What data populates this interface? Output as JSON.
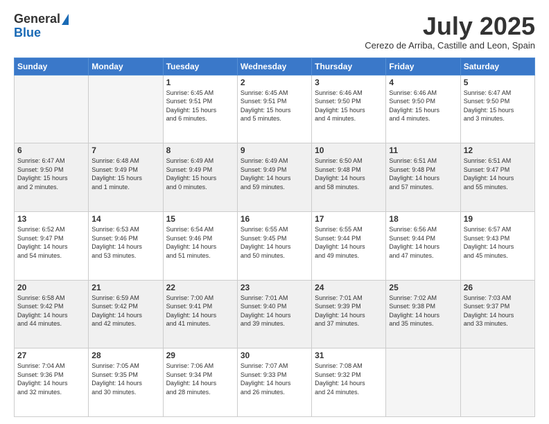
{
  "header": {
    "logo_general": "General",
    "logo_blue": "Blue",
    "month_title": "July 2025",
    "location": "Cerezo de Arriba, Castille and Leon, Spain"
  },
  "weekdays": [
    "Sunday",
    "Monday",
    "Tuesday",
    "Wednesday",
    "Thursday",
    "Friday",
    "Saturday"
  ],
  "weeks": [
    [
      {
        "day": "",
        "info": ""
      },
      {
        "day": "",
        "info": ""
      },
      {
        "day": "1",
        "info": "Sunrise: 6:45 AM\nSunset: 9:51 PM\nDaylight: 15 hours\nand 6 minutes."
      },
      {
        "day": "2",
        "info": "Sunrise: 6:45 AM\nSunset: 9:51 PM\nDaylight: 15 hours\nand 5 minutes."
      },
      {
        "day": "3",
        "info": "Sunrise: 6:46 AM\nSunset: 9:50 PM\nDaylight: 15 hours\nand 4 minutes."
      },
      {
        "day": "4",
        "info": "Sunrise: 6:46 AM\nSunset: 9:50 PM\nDaylight: 15 hours\nand 4 minutes."
      },
      {
        "day": "5",
        "info": "Sunrise: 6:47 AM\nSunset: 9:50 PM\nDaylight: 15 hours\nand 3 minutes."
      }
    ],
    [
      {
        "day": "6",
        "info": "Sunrise: 6:47 AM\nSunset: 9:50 PM\nDaylight: 15 hours\nand 2 minutes."
      },
      {
        "day": "7",
        "info": "Sunrise: 6:48 AM\nSunset: 9:49 PM\nDaylight: 15 hours\nand 1 minute."
      },
      {
        "day": "8",
        "info": "Sunrise: 6:49 AM\nSunset: 9:49 PM\nDaylight: 15 hours\nand 0 minutes."
      },
      {
        "day": "9",
        "info": "Sunrise: 6:49 AM\nSunset: 9:49 PM\nDaylight: 14 hours\nand 59 minutes."
      },
      {
        "day": "10",
        "info": "Sunrise: 6:50 AM\nSunset: 9:48 PM\nDaylight: 14 hours\nand 58 minutes."
      },
      {
        "day": "11",
        "info": "Sunrise: 6:51 AM\nSunset: 9:48 PM\nDaylight: 14 hours\nand 57 minutes."
      },
      {
        "day": "12",
        "info": "Sunrise: 6:51 AM\nSunset: 9:47 PM\nDaylight: 14 hours\nand 55 minutes."
      }
    ],
    [
      {
        "day": "13",
        "info": "Sunrise: 6:52 AM\nSunset: 9:47 PM\nDaylight: 14 hours\nand 54 minutes."
      },
      {
        "day": "14",
        "info": "Sunrise: 6:53 AM\nSunset: 9:46 PM\nDaylight: 14 hours\nand 53 minutes."
      },
      {
        "day": "15",
        "info": "Sunrise: 6:54 AM\nSunset: 9:46 PM\nDaylight: 14 hours\nand 51 minutes."
      },
      {
        "day": "16",
        "info": "Sunrise: 6:55 AM\nSunset: 9:45 PM\nDaylight: 14 hours\nand 50 minutes."
      },
      {
        "day": "17",
        "info": "Sunrise: 6:55 AM\nSunset: 9:44 PM\nDaylight: 14 hours\nand 49 minutes."
      },
      {
        "day": "18",
        "info": "Sunrise: 6:56 AM\nSunset: 9:44 PM\nDaylight: 14 hours\nand 47 minutes."
      },
      {
        "day": "19",
        "info": "Sunrise: 6:57 AM\nSunset: 9:43 PM\nDaylight: 14 hours\nand 45 minutes."
      }
    ],
    [
      {
        "day": "20",
        "info": "Sunrise: 6:58 AM\nSunset: 9:42 PM\nDaylight: 14 hours\nand 44 minutes."
      },
      {
        "day": "21",
        "info": "Sunrise: 6:59 AM\nSunset: 9:42 PM\nDaylight: 14 hours\nand 42 minutes."
      },
      {
        "day": "22",
        "info": "Sunrise: 7:00 AM\nSunset: 9:41 PM\nDaylight: 14 hours\nand 41 minutes."
      },
      {
        "day": "23",
        "info": "Sunrise: 7:01 AM\nSunset: 9:40 PM\nDaylight: 14 hours\nand 39 minutes."
      },
      {
        "day": "24",
        "info": "Sunrise: 7:01 AM\nSunset: 9:39 PM\nDaylight: 14 hours\nand 37 minutes."
      },
      {
        "day": "25",
        "info": "Sunrise: 7:02 AM\nSunset: 9:38 PM\nDaylight: 14 hours\nand 35 minutes."
      },
      {
        "day": "26",
        "info": "Sunrise: 7:03 AM\nSunset: 9:37 PM\nDaylight: 14 hours\nand 33 minutes."
      }
    ],
    [
      {
        "day": "27",
        "info": "Sunrise: 7:04 AM\nSunset: 9:36 PM\nDaylight: 14 hours\nand 32 minutes."
      },
      {
        "day": "28",
        "info": "Sunrise: 7:05 AM\nSunset: 9:35 PM\nDaylight: 14 hours\nand 30 minutes."
      },
      {
        "day": "29",
        "info": "Sunrise: 7:06 AM\nSunset: 9:34 PM\nDaylight: 14 hours\nand 28 minutes."
      },
      {
        "day": "30",
        "info": "Sunrise: 7:07 AM\nSunset: 9:33 PM\nDaylight: 14 hours\nand 26 minutes."
      },
      {
        "day": "31",
        "info": "Sunrise: 7:08 AM\nSunset: 9:32 PM\nDaylight: 14 hours\nand 24 minutes."
      },
      {
        "day": "",
        "info": ""
      },
      {
        "day": "",
        "info": ""
      }
    ]
  ]
}
